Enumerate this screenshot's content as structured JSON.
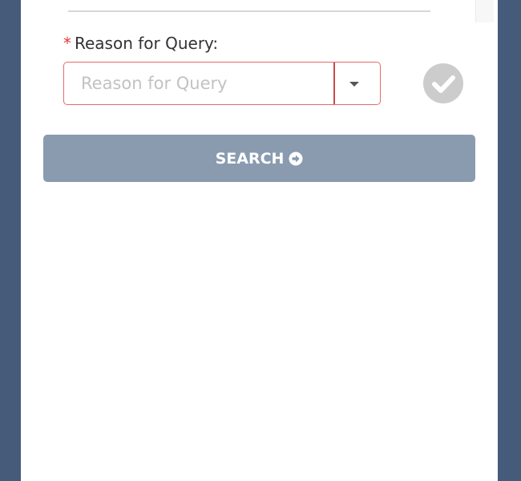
{
  "form": {
    "reason_field": {
      "required_marker": "*",
      "label": "Reason for Query:",
      "placeholder": "Reason for Query"
    },
    "search_button": {
      "label": "SEARCH"
    }
  },
  "icons": {
    "toggle": "caret-down-icon",
    "validation": "check-circle-icon",
    "button": "arrow-circle-right-icon"
  },
  "colors": {
    "page_background": "#465b7a",
    "required": "#e23b3b",
    "error_border": "#e46b6b",
    "button_background": "#8a9bb0",
    "check_background": "#cccccc"
  }
}
